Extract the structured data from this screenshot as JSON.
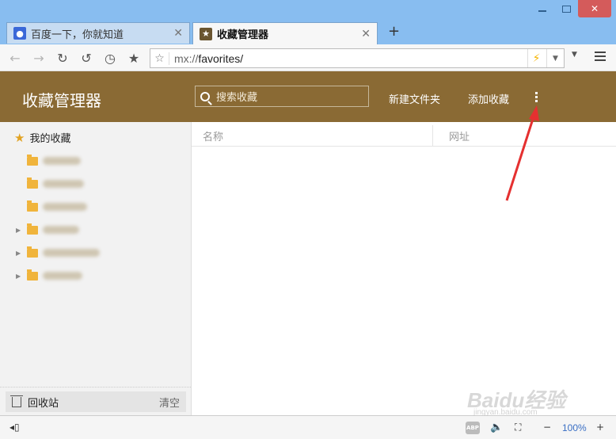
{
  "window": {
    "tabs": [
      {
        "label": "百度一下，你就知道",
        "active": false,
        "icon": "baidu-paw-icon"
      },
      {
        "label": "收藏管理器",
        "active": true,
        "icon": "star-badge-icon"
      }
    ],
    "new_tab_symbol": "+",
    "close_symbol": "✕"
  },
  "toolbar": {
    "address": {
      "scheme": "mx://",
      "path": "favorites/"
    },
    "buttons": [
      "back-icon",
      "forward-icon",
      "reload-icon",
      "undo-icon",
      "history-icon",
      "favorites-star-icon"
    ]
  },
  "header": {
    "title": "收藏管理器",
    "search_placeholder": "搜索收藏",
    "new_folder_label": "新建文件夹",
    "add_favorite_label": "添加收藏",
    "accent_color": "#8a6a34"
  },
  "sidebar": {
    "root_label": "我的收藏",
    "folders": [
      {
        "expandable": false
      },
      {
        "expandable": false
      },
      {
        "expandable": false
      },
      {
        "expandable": true
      },
      {
        "expandable": true
      },
      {
        "expandable": true
      }
    ],
    "recycle_label": "回收站",
    "clear_label": "清空"
  },
  "main": {
    "columns": [
      "名称",
      "网址"
    ]
  },
  "statusbar": {
    "abp_label": "ABP",
    "zoom": "100%"
  },
  "watermark": {
    "text": "Baidu经验",
    "sub": "jingyan.baidu.com"
  },
  "annotation_color": "#e53030"
}
